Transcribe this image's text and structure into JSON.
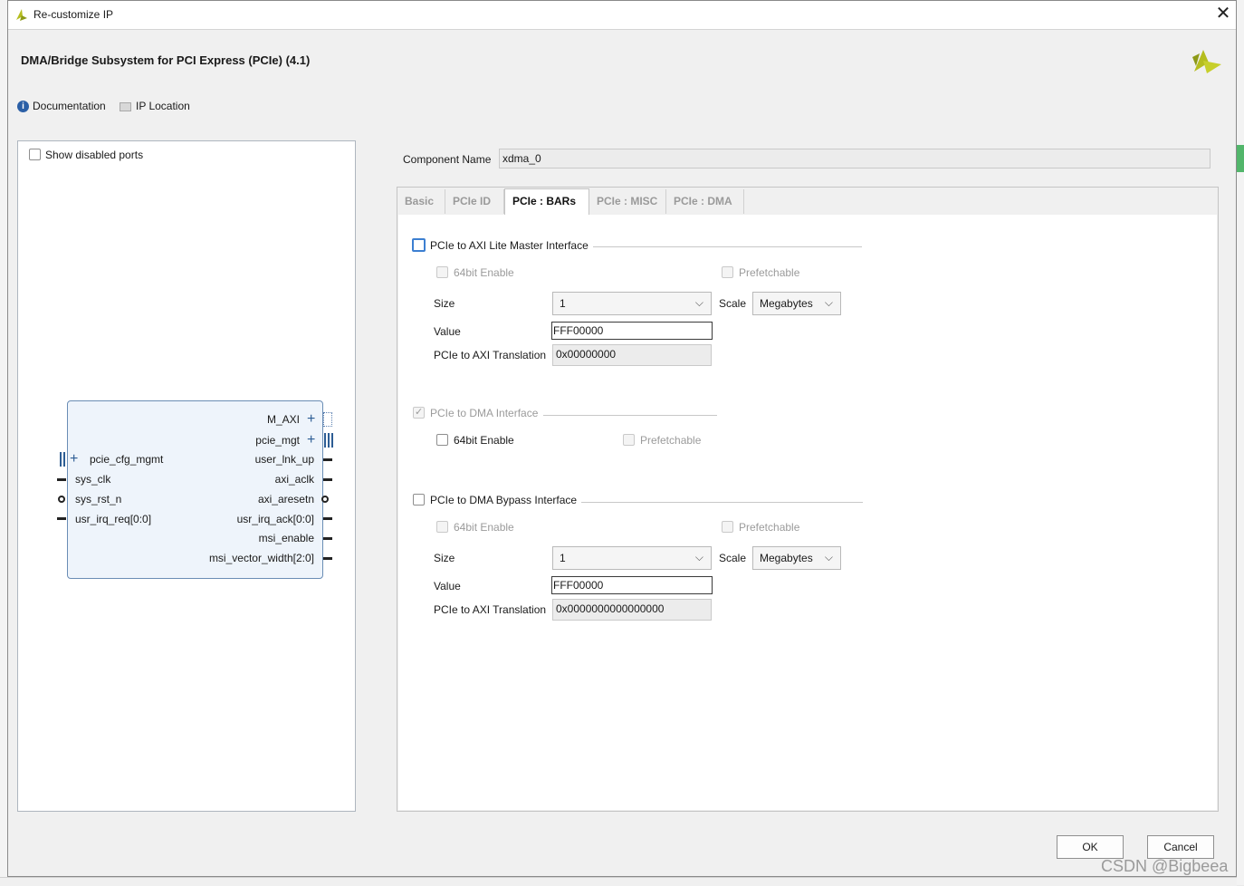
{
  "window": {
    "title": "Re-customize IP",
    "ip_name": "DMA/Bridge Subsystem for PCI Express (PCIe) (4.1)"
  },
  "toolbar": {
    "documentation": "Documentation",
    "ip_location": "IP Location"
  },
  "left_panel": {
    "show_disabled_ports": "Show disabled ports",
    "block": {
      "right_ports": [
        "M_AXI",
        "pcie_mgt",
        "user_lnk_up",
        "axi_aclk",
        "axi_aresetn",
        "usr_irq_ack[0:0]",
        "msi_enable",
        "msi_vector_width[2:0]"
      ],
      "left_ports": [
        "pcie_cfg_mgmt",
        "sys_clk",
        "sys_rst_n",
        "usr_irq_req[0:0]"
      ]
    }
  },
  "component": {
    "label": "Component Name",
    "value": "xdma_0"
  },
  "tabs": [
    {
      "label": "Basic"
    },
    {
      "label": "PCIe ID"
    },
    {
      "label": "PCIe : BARs"
    },
    {
      "label": "PCIe : MISC"
    },
    {
      "label": "PCIe : DMA"
    }
  ],
  "bars": {
    "axi_lite": {
      "title": "PCIe to AXI Lite Master Interface",
      "enable64": "64bit Enable",
      "prefetchable": "Prefetchable",
      "size_label": "Size",
      "size_value": "1",
      "scale_label": "Scale",
      "scale_value": "Megabytes",
      "value_label": "Value",
      "value": "FFF00000",
      "translation_label": "PCIe to AXI Translation",
      "translation": "0x00000000"
    },
    "dma": {
      "title": "PCIe to DMA Interface",
      "enable64": "64bit Enable",
      "prefetchable": "Prefetchable"
    },
    "bypass": {
      "title": "PCIe to DMA Bypass Interface",
      "enable64": "64bit Enable",
      "prefetchable": "Prefetchable",
      "size_label": "Size",
      "size_value": "1",
      "scale_label": "Scale",
      "scale_value": "Megabytes",
      "value_label": "Value",
      "value": "FFF00000",
      "translation_label": "PCIe to AXI Translation",
      "translation": "0x0000000000000000"
    }
  },
  "buttons": {
    "ok": "OK",
    "cancel": "Cancel"
  },
  "watermark": "CSDN @Bigbeea",
  "colors": {
    "xilinx_logo": "#b5bd1e",
    "focus_blue": "#3c7fd1",
    "block_fill": "#eef4fb"
  }
}
